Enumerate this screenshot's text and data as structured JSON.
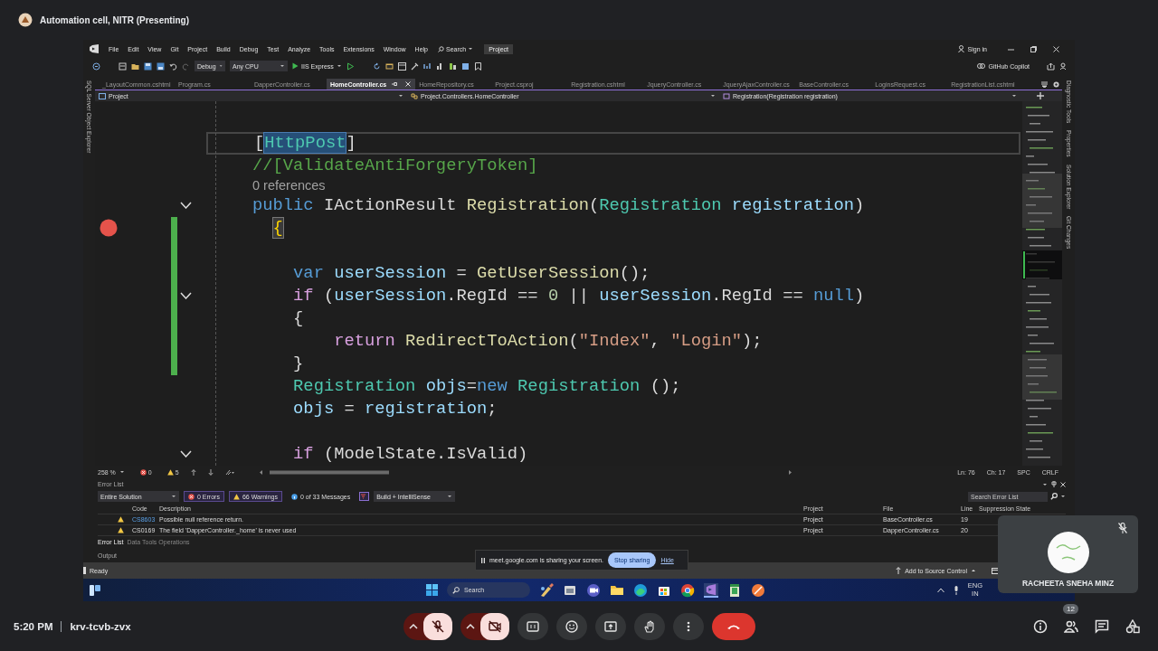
{
  "meet": {
    "title": "Automation cell, NITR (Presenting)",
    "time": "5:20 PM",
    "meeting_code": "krv-tcvb-zvx",
    "controls": [
      {
        "kind": "mic",
        "on": false
      },
      {
        "kind": "camera",
        "on": false
      },
      {
        "kind": "captions"
      },
      {
        "kind": "emoji"
      },
      {
        "kind": "present"
      },
      {
        "kind": "hand"
      },
      {
        "kind": "more"
      },
      {
        "kind": "leave"
      }
    ],
    "side_controls": [
      {
        "kind": "info"
      },
      {
        "kind": "people",
        "badge": "12"
      },
      {
        "kind": "chat"
      },
      {
        "kind": "activities"
      }
    ],
    "participant": {
      "name": "RACHEETA SNEHA MINZ",
      "muted": true
    },
    "share_banner": {
      "message": "meet.google.com is sharing your screen.",
      "stop": "Stop sharing",
      "hide": "Hide"
    }
  },
  "ide": {
    "menu": [
      "File",
      "Edit",
      "View",
      "Git",
      "Project",
      "Build",
      "Debug",
      "Test",
      "Analyze",
      "Tools",
      "Extensions",
      "Window",
      "Help"
    ],
    "search": "Search",
    "solution": "Project",
    "sign_in": "Sign in",
    "copilot": "GitHub Copilot",
    "toolbar": {
      "configuration": "Debug",
      "platform": "Any CPU",
      "run": "IIS Express"
    },
    "left_tool_tabs": [
      "SQL Server Object Explorer"
    ],
    "right_tool_tabs": [
      "Diagnostic Tools",
      "Properties",
      "Solution Explorer",
      "Git Changes"
    ],
    "tabs": [
      {
        "label": "_LayoutCommon.cshtml",
        "selected": false
      },
      {
        "label": "Program.cs",
        "selected": false
      },
      {
        "label": "DapperController.cs",
        "selected": false
      },
      {
        "label": "HomeController.cs",
        "selected": true
      },
      {
        "label": "HomeRepository.cs",
        "selected": false
      },
      {
        "label": "Project.csproj",
        "selected": false
      },
      {
        "label": "Registration.cshtml",
        "selected": false
      },
      {
        "label": "JqueryController.cs",
        "selected": false
      },
      {
        "label": "JqueryAjaxController.cs",
        "selected": false
      },
      {
        "label": "BaseController.cs",
        "selected": false
      },
      {
        "label": "LoginsRequest.cs",
        "selected": false
      },
      {
        "label": "RegistrationList.cshtml",
        "selected": false
      }
    ],
    "navbar": {
      "project": "Project",
      "class": "Project.Controllers.HomeController",
      "member": "Registration(Registration registration)"
    },
    "editor": {
      "lines": [
        {
          "kind": "code",
          "breakpoint": false,
          "changed": false,
          "fold": false,
          "current": true,
          "tokens": [
            {
              "text": "[",
              "kind": "plain"
            },
            {
              "text": "HttpPost",
              "kind": "sel"
            },
            {
              "text": "]",
              "kind": "plain"
            }
          ]
        },
        {
          "kind": "code",
          "breakpoint": false,
          "changed": false,
          "fold": false,
          "current": false,
          "tokens": [
            {
              "text": "//[ValidateAntiForgeryToken]",
              "kind": "comment"
            }
          ]
        },
        {
          "kind": "codelens",
          "breakpoint": false,
          "changed": false,
          "fold": false,
          "current": false,
          "text": "0 references"
        },
        {
          "kind": "code",
          "breakpoint": false,
          "changed": false,
          "fold": true,
          "current": false,
          "tokens": [
            {
              "text": "public",
              "kind": "kw"
            },
            {
              "text": " IActionResult ",
              "kind": "plain"
            },
            {
              "text": "Registration",
              "kind": "method"
            },
            {
              "text": "(",
              "kind": "plain"
            },
            {
              "text": "Registration",
              "kind": "type"
            },
            {
              "text": " registration",
              "kind": "var"
            },
            {
              "text": ")",
              "kind": "plain"
            }
          ]
        },
        {
          "kind": "code",
          "breakpoint": true,
          "changed": true,
          "fold": false,
          "current": false,
          "tokens": [
            {
              "text": "  {",
              "kind": "brace"
            }
          ]
        },
        {
          "kind": "blank",
          "breakpoint": false,
          "changed": true,
          "fold": false,
          "current": false
        },
        {
          "kind": "code",
          "breakpoint": false,
          "changed": true,
          "fold": false,
          "current": false,
          "tokens": [
            {
              "text": "    var",
              "kind": "kw"
            },
            {
              "text": " userSession",
              "kind": "var"
            },
            {
              "text": " = ",
              "kind": "plain"
            },
            {
              "text": "GetUserSession",
              "kind": "method"
            },
            {
              "text": "();",
              "kind": "plain"
            }
          ]
        },
        {
          "kind": "code",
          "breakpoint": false,
          "changed": true,
          "fold": true,
          "current": false,
          "tokens": [
            {
              "text": "    if",
              "kind": "ctl"
            },
            {
              "text": " (",
              "kind": "plain"
            },
            {
              "text": "userSession",
              "kind": "var"
            },
            {
              "text": ".RegId == ",
              "kind": "plain"
            },
            {
              "text": "0",
              "kind": "num"
            },
            {
              "text": " || ",
              "kind": "plain"
            },
            {
              "text": "userSession",
              "kind": "var"
            },
            {
              "text": ".RegId == ",
              "kind": "plain"
            },
            {
              "text": "null",
              "kind": "kw"
            },
            {
              "text": ")",
              "kind": "plain"
            }
          ]
        },
        {
          "kind": "code",
          "breakpoint": false,
          "changed": true,
          "fold": false,
          "current": false,
          "tokens": [
            {
              "text": "    {",
              "kind": "plain"
            }
          ]
        },
        {
          "kind": "code",
          "breakpoint": false,
          "changed": true,
          "fold": false,
          "current": false,
          "tokens": [
            {
              "text": "        return",
              "kind": "ctl"
            },
            {
              "text": " RedirectToAction",
              "kind": "method"
            },
            {
              "text": "(",
              "kind": "plain"
            },
            {
              "text": "\"Index\"",
              "kind": "str"
            },
            {
              "text": ", ",
              "kind": "plain"
            },
            {
              "text": "\"Login\"",
              "kind": "str"
            },
            {
              "text": ");",
              "kind": "plain"
            }
          ]
        },
        {
          "kind": "code",
          "breakpoint": false,
          "changed": true,
          "fold": false,
          "current": false,
          "tokens": [
            {
              "text": "    }",
              "kind": "plain"
            }
          ]
        },
        {
          "kind": "code",
          "breakpoint": false,
          "changed": false,
          "fold": false,
          "current": false,
          "tokens": [
            {
              "text": "    Registration",
              "kind": "type"
            },
            {
              "text": " objs",
              "kind": "var"
            },
            {
              "text": "=",
              "kind": "plain"
            },
            {
              "text": "new",
              "kind": "kw"
            },
            {
              "text": " Registration",
              "kind": "type"
            },
            {
              "text": " ();",
              "kind": "plain"
            }
          ]
        },
        {
          "kind": "code",
          "breakpoint": false,
          "changed": false,
          "fold": false,
          "current": false,
          "tokens": [
            {
              "text": "    objs",
              "kind": "var"
            },
            {
              "text": " = ",
              "kind": "plain"
            },
            {
              "text": "registration",
              "kind": "var"
            },
            {
              "text": ";",
              "kind": "plain"
            }
          ]
        },
        {
          "kind": "blank",
          "breakpoint": false,
          "changed": false,
          "fold": false,
          "current": false
        },
        {
          "kind": "code",
          "breakpoint": false,
          "changed": false,
          "fold": true,
          "current": false,
          "tokens": [
            {
              "text": "    if",
              "kind": "ctl"
            },
            {
              "text": " (ModelState.IsValid)",
              "kind": "plain"
            }
          ]
        }
      ]
    },
    "editor_status": {
      "zoom": "258 %",
      "errors": "0",
      "warnings": "5",
      "line": "Ln: 76",
      "column": "Ch: 17",
      "indent": "SPC",
      "line_ending": "CRLF"
    },
    "error_list": {
      "title": "Error List",
      "scope": "Entire Solution",
      "filters": [
        {
          "label": "0 Errors",
          "kind": "error",
          "selected": true
        },
        {
          "label": "66 Warnings",
          "kind": "warning",
          "selected": true
        },
        {
          "label": "0 of 33 Messages",
          "kind": "info",
          "selected": false
        }
      ],
      "source": "Build + IntelliSense",
      "search": {
        "placeholder": "Search Error List"
      },
      "columns": [
        "Code",
        "Description",
        "Project",
        "File",
        "Line",
        "Suppression State"
      ],
      "rows": [
        {
          "kind": "warning",
          "code": "CS8603",
          "linked": true,
          "description": "Possible null reference return.",
          "project": "Project",
          "file": "BaseController.cs",
          "line": "19"
        },
        {
          "kind": "warning",
          "code": "CS0169",
          "linked": false,
          "description": "The field 'DapperController._home' is never used",
          "project": "Project",
          "file": "DapperController.cs",
          "line": "20"
        }
      ],
      "tabs": [
        {
          "label": "Error List",
          "selected": true
        },
        {
          "label": "Data Tools Operations",
          "selected": false
        }
      ]
    },
    "output": {
      "title": "Output"
    },
    "status_bar": {
      "state": "Ready",
      "source_control": "Add to Source Control"
    }
  },
  "taskbar": {
    "search": "Search",
    "language": [
      "ENG",
      "IN"
    ],
    "apps": [
      {
        "kind": "paint",
        "selected": false
      },
      {
        "kind": "window",
        "selected": false
      },
      {
        "kind": "video",
        "selected": false
      },
      {
        "kind": "folder",
        "selected": false
      },
      {
        "kind": "edge",
        "selected": false
      },
      {
        "kind": "store",
        "selected": false
      },
      {
        "kind": "chrome",
        "selected": false
      },
      {
        "kind": "vs",
        "selected": true
      },
      {
        "kind": "sheet",
        "selected": false
      },
      {
        "kind": "orange",
        "selected": false
      }
    ]
  }
}
